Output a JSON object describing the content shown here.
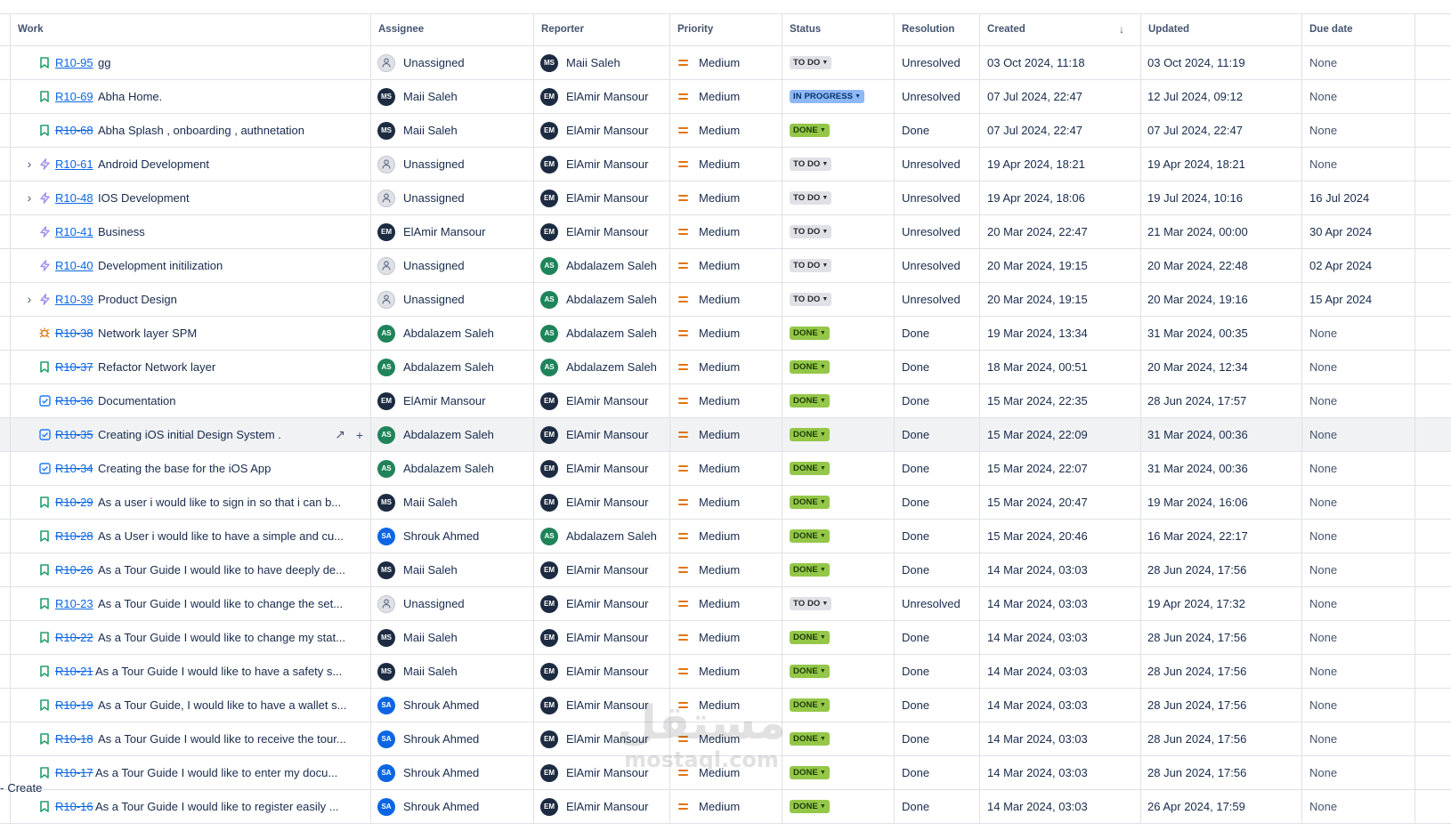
{
  "columns": {
    "work": "Work",
    "assignee": "Assignee",
    "reporter": "Reporter",
    "priority": "Priority",
    "status": "Status",
    "resolution": "Resolution",
    "created": "Created",
    "updated": "Updated",
    "due": "Due date"
  },
  "icons": {
    "sort": "arrow-down-icon",
    "story": "bookmark-icon",
    "epic": "lightning-icon",
    "bug": "bug-icon",
    "task": "checkbox-icon",
    "expand": "chevron-right-icon",
    "open": "arrow-up-right-icon",
    "add": "plus-icon"
  },
  "colors": {
    "story": "#22a06b",
    "epic": "#9f8fef",
    "bug": "#e2740d",
    "task": "#1d7afc",
    "priority_medium": "#e2740d",
    "link": "#0c66e4"
  },
  "people": {
    "MS": {
      "initials": "MS",
      "color": "#1c2b41"
    },
    "EM": {
      "initials": "EM",
      "color": "#1c2b41"
    },
    "AS": {
      "initials": "AS",
      "color": "#1f845a"
    },
    "SA": {
      "initials": "SA",
      "color": "#0c66e4"
    }
  },
  "rows": [
    {
      "key": "R10-95",
      "summary": "gg",
      "type": "story",
      "expandable": false,
      "done": false,
      "assignee": "Unassigned",
      "assignee_av": "",
      "reporter": "Maii Saleh",
      "reporter_av": "MS",
      "priority": "Medium",
      "status": "TO DO",
      "status_kind": "todo",
      "resolution": "Unresolved",
      "created": "03 Oct 2024, 11:18",
      "updated": "03 Oct 2024, 11:19",
      "due": "None"
    },
    {
      "key": "R10-69",
      "summary": "Abha Home.",
      "type": "story",
      "expandable": false,
      "done": false,
      "assignee": "Maii Saleh",
      "assignee_av": "MS",
      "reporter": "ElAmir Mansour",
      "reporter_av": "EM",
      "priority": "Medium",
      "status": "IN PROGRESS",
      "status_kind": "progress",
      "resolution": "Unresolved",
      "created": "07 Jul 2024, 22:47",
      "updated": "12 Jul 2024, 09:12",
      "due": "None"
    },
    {
      "key": "R10-68",
      "summary": "Abha Splash , onboarding , authnetation",
      "type": "story",
      "expandable": false,
      "done": true,
      "assignee": "Maii Saleh",
      "assignee_av": "MS",
      "reporter": "ElAmir Mansour",
      "reporter_av": "EM",
      "priority": "Medium",
      "status": "DONE",
      "status_kind": "done",
      "resolution": "Done",
      "created": "07 Jul 2024, 22:47",
      "updated": "07 Jul 2024, 22:47",
      "due": "None"
    },
    {
      "key": "R10-61",
      "summary": "Android Development",
      "type": "epic",
      "expandable": true,
      "done": false,
      "assignee": "Unassigned",
      "assignee_av": "",
      "reporter": "ElAmir Mansour",
      "reporter_av": "EM",
      "priority": "Medium",
      "status": "TO DO",
      "status_kind": "todo",
      "resolution": "Unresolved",
      "created": "19 Apr 2024, 18:21",
      "updated": "19 Apr 2024, 18:21",
      "due": "None"
    },
    {
      "key": "R10-48",
      "summary": "IOS Development",
      "type": "epic",
      "expandable": true,
      "done": false,
      "assignee": "Unassigned",
      "assignee_av": "",
      "reporter": "ElAmir Mansour",
      "reporter_av": "EM",
      "priority": "Medium",
      "status": "TO DO",
      "status_kind": "todo",
      "resolution": "Unresolved",
      "created": "19 Apr 2024, 18:06",
      "updated": "19 Jul 2024, 10:16",
      "due": "16 Jul 2024"
    },
    {
      "key": "R10-41",
      "summary": "Business",
      "type": "epic",
      "expandable": false,
      "done": false,
      "assignee": "ElAmir Mansour",
      "assignee_av": "EM",
      "reporter": "ElAmir Mansour",
      "reporter_av": "EM",
      "priority": "Medium",
      "status": "TO DO",
      "status_kind": "todo",
      "resolution": "Unresolved",
      "created": "20 Mar 2024, 22:47",
      "updated": "21 Mar 2024, 00:00",
      "due": "30 Apr 2024"
    },
    {
      "key": "R10-40",
      "summary": "Development initilization",
      "type": "epic",
      "expandable": false,
      "done": false,
      "assignee": "Unassigned",
      "assignee_av": "",
      "reporter": "Abdalazem Saleh",
      "reporter_av": "AS",
      "priority": "Medium",
      "status": "TO DO",
      "status_kind": "todo",
      "resolution": "Unresolved",
      "created": "20 Mar 2024, 19:15",
      "updated": "20 Mar 2024, 22:48",
      "due": "02 Apr 2024"
    },
    {
      "key": "R10-39",
      "summary": "Product Design",
      "type": "epic",
      "expandable": true,
      "done": false,
      "assignee": "Unassigned",
      "assignee_av": "",
      "reporter": "Abdalazem Saleh",
      "reporter_av": "AS",
      "priority": "Medium",
      "status": "TO DO",
      "status_kind": "todo",
      "resolution": "Unresolved",
      "created": "20 Mar 2024, 19:15",
      "updated": "20 Mar 2024, 19:16",
      "due": "15 Apr 2024"
    },
    {
      "key": "R10-38",
      "summary": "Network layer SPM",
      "type": "bug",
      "expandable": false,
      "done": true,
      "assignee": "Abdalazem Saleh",
      "assignee_av": "AS",
      "reporter": "Abdalazem Saleh",
      "reporter_av": "AS",
      "priority": "Medium",
      "status": "DONE",
      "status_kind": "done",
      "resolution": "Done",
      "created": "19 Mar 2024, 13:34",
      "updated": "31 Mar 2024, 00:35",
      "due": "None"
    },
    {
      "key": "R10-37",
      "summary": "Refactor Network layer",
      "type": "story",
      "expandable": false,
      "done": true,
      "assignee": "Abdalazem Saleh",
      "assignee_av": "AS",
      "reporter": "Abdalazem Saleh",
      "reporter_av": "AS",
      "priority": "Medium",
      "status": "DONE",
      "status_kind": "done",
      "resolution": "Done",
      "created": "18 Mar 2024, 00:51",
      "updated": "20 Mar 2024, 12:34",
      "due": "None"
    },
    {
      "key": "R10-36",
      "summary": "Documentation",
      "type": "task",
      "expandable": false,
      "done": true,
      "assignee": "ElAmir Mansour",
      "assignee_av": "EM",
      "reporter": "ElAmir Mansour",
      "reporter_av": "EM",
      "priority": "Medium",
      "status": "DONE",
      "status_kind": "done",
      "resolution": "Done",
      "created": "15 Mar 2024, 22:35",
      "updated": "28 Jun 2024, 17:57",
      "due": "None"
    },
    {
      "key": "R10-35",
      "summary": "Creating iOS initial Design System .",
      "type": "task",
      "expandable": false,
      "done": true,
      "hover": true,
      "assignee": "Abdalazem Saleh",
      "assignee_av": "AS",
      "reporter": "ElAmir Mansour",
      "reporter_av": "EM",
      "priority": "Medium",
      "status": "DONE",
      "status_kind": "done",
      "resolution": "Done",
      "created": "15 Mar 2024, 22:09",
      "updated": "31 Mar 2024, 00:36",
      "due": "None"
    },
    {
      "key": "R10-34",
      "summary": "Creating the base for the iOS App",
      "type": "task",
      "expandable": false,
      "done": true,
      "assignee": "Abdalazem Saleh",
      "assignee_av": "AS",
      "reporter": "ElAmir Mansour",
      "reporter_av": "EM",
      "priority": "Medium",
      "status": "DONE",
      "status_kind": "done",
      "resolution": "Done",
      "created": "15 Mar 2024, 22:07",
      "updated": "31 Mar 2024, 00:36",
      "due": "None"
    },
    {
      "key": "R10-29",
      "summary": "As a user i would like to sign in so that i can b...",
      "type": "story",
      "expandable": false,
      "done": true,
      "assignee": "Maii Saleh",
      "assignee_av": "MS",
      "reporter": "ElAmir Mansour",
      "reporter_av": "EM",
      "priority": "Medium",
      "status": "DONE",
      "status_kind": "done",
      "resolution": "Done",
      "created": "15 Mar 2024, 20:47",
      "updated": "19 Mar 2024, 16:06",
      "due": "None"
    },
    {
      "key": "R10-28",
      "summary": "As a User i would like to have a simple and cu...",
      "type": "story",
      "expandable": false,
      "done": true,
      "assignee": "Shrouk Ahmed",
      "assignee_av": "SA",
      "reporter": "Abdalazem Saleh",
      "reporter_av": "AS",
      "priority": "Medium",
      "status": "DONE",
      "status_kind": "done",
      "resolution": "Done",
      "created": "15 Mar 2024, 20:46",
      "updated": "16 Mar 2024, 22:17",
      "due": "None"
    },
    {
      "key": "R10-26",
      "summary": "As a Tour Guide I would like to have deeply de...",
      "type": "story",
      "expandable": false,
      "done": true,
      "assignee": "Maii Saleh",
      "assignee_av": "MS",
      "reporter": "ElAmir Mansour",
      "reporter_av": "EM",
      "priority": "Medium",
      "status": "DONE",
      "status_kind": "done",
      "resolution": "Done",
      "created": "14 Mar 2024, 03:03",
      "updated": "28 Jun 2024, 17:56",
      "due": "None"
    },
    {
      "key": "R10-23",
      "summary": "As a Tour Guide I would like to change the set...",
      "type": "story",
      "expandable": false,
      "done": false,
      "assignee": "Unassigned",
      "assignee_av": "",
      "reporter": "ElAmir Mansour",
      "reporter_av": "EM",
      "priority": "Medium",
      "status": "TO DO",
      "status_kind": "todo",
      "resolution": "Unresolved",
      "created": "14 Mar 2024, 03:03",
      "updated": "19 Apr 2024, 17:32",
      "due": "None"
    },
    {
      "key": "R10-22",
      "summary": "As a Tour Guide I would like to change my stat...",
      "type": "story",
      "expandable": false,
      "done": true,
      "assignee": "Maii Saleh",
      "assignee_av": "MS",
      "reporter": "ElAmir Mansour",
      "reporter_av": "EM",
      "priority": "Medium",
      "status": "DONE",
      "status_kind": "done",
      "resolution": "Done",
      "created": "14 Mar 2024, 03:03",
      "updated": "28 Jun 2024, 17:56",
      "due": "None"
    },
    {
      "key": "R10-21",
      "summary": "As a Tour Guide I would like to have a safety s...",
      "type": "story",
      "expandable": false,
      "done": true,
      "assignee": "Maii Saleh",
      "assignee_av": "MS",
      "reporter": "ElAmir Mansour",
      "reporter_av": "EM",
      "priority": "Medium",
      "status": "DONE",
      "status_kind": "done",
      "resolution": "Done",
      "created": "14 Mar 2024, 03:03",
      "updated": "28 Jun 2024, 17:56",
      "due": "None"
    },
    {
      "key": "R10-19",
      "summary": "As a Tour Guide, I would like to have a wallet s...",
      "type": "story",
      "expandable": false,
      "done": true,
      "assignee": "Shrouk Ahmed",
      "assignee_av": "SA",
      "reporter": "ElAmir Mansour",
      "reporter_av": "EM",
      "priority": "Medium",
      "status": "DONE",
      "status_kind": "done",
      "resolution": "Done",
      "created": "14 Mar 2024, 03:03",
      "updated": "28 Jun 2024, 17:56",
      "due": "None"
    },
    {
      "key": "R10-18",
      "summary": "As a Tour Guide I would like to receive the tour...",
      "type": "story",
      "expandable": false,
      "done": true,
      "assignee": "Shrouk Ahmed",
      "assignee_av": "SA",
      "reporter": "ElAmir Mansour",
      "reporter_av": "EM",
      "priority": "Medium",
      "status": "DONE",
      "status_kind": "done",
      "resolution": "Done",
      "created": "14 Mar 2024, 03:03",
      "updated": "28 Jun 2024, 17:56",
      "due": "None"
    },
    {
      "key": "R10-17",
      "summary": "As a Tour Guide I would like to enter my docu...",
      "type": "story",
      "expandable": false,
      "done": true,
      "assignee": "Shrouk Ahmed",
      "assignee_av": "SA",
      "reporter": "ElAmir Mansour",
      "reporter_av": "EM",
      "priority": "Medium",
      "status": "DONE",
      "status_kind": "done",
      "resolution": "Done",
      "created": "14 Mar 2024, 03:03",
      "updated": "28 Jun 2024, 17:56",
      "due": "None"
    },
    {
      "key": "R10-16",
      "summary": "As a Tour Guide I would like to register easily ...",
      "type": "story",
      "expandable": false,
      "done": true,
      "assignee": "Shrouk Ahmed",
      "assignee_av": "SA",
      "reporter": "ElAmir Mansour",
      "reporter_av": "EM",
      "priority": "Medium",
      "status": "DONE",
      "status_kind": "done",
      "resolution": "Done",
      "created": "14 Mar 2024, 03:03",
      "updated": "26 Apr 2024, 17:59",
      "due": "None"
    }
  ],
  "footer": {
    "create_label": "Create"
  },
  "watermark": {
    "arabic": "مستقل",
    "latin": "mostaql.com"
  }
}
